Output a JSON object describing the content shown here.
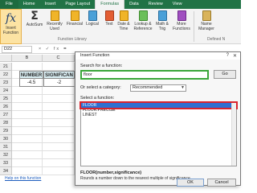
{
  "ribbon": {
    "tabs": [
      "File",
      "Home",
      "Insert",
      "Page Layout",
      "Formulas",
      "Data",
      "Review",
      "View"
    ],
    "active_tab": "Formulas",
    "buttons": {
      "insert_function": "Insert\nFunction",
      "autosum": "AutoSum",
      "recently_used": "Recently\nUsed",
      "financial": "Financial",
      "logical": "Logical",
      "text": "Text",
      "date_time": "Date &\nTime",
      "lookup_reference": "Lookup &\nReference",
      "math_trig": "Math &\nTrig",
      "more_functions": "More\nFunctions",
      "name_manager": "Name\nManager"
    },
    "group_label": "Function Library",
    "group_label2": "Defined N",
    "colors": {
      "tab_bar": "#217346",
      "insert_highlight": "#fce3a3"
    }
  },
  "formula_bar": {
    "name_box": "D22",
    "icons": "× ✓ fx",
    "content": "="
  },
  "grid": {
    "columns": [
      "B",
      "C"
    ],
    "rows": [
      "21",
      "22",
      "23",
      "24",
      "25",
      "26",
      "27",
      "28",
      "29",
      "30",
      "31",
      "32",
      "33",
      "34"
    ],
    "header_cells": [
      "NUMBER",
      "SIGNIFICAN"
    ],
    "value_cells": [
      "-4.5",
      "-2"
    ]
  },
  "dialog": {
    "title": "Insert Function",
    "help_glyph": "?",
    "close_glyph": "✕",
    "search_label": "Search for a function:",
    "search_value": "floor",
    "go_label": "Go",
    "category_label": "Or select a category:",
    "category_value": "Recommended",
    "select_label": "Select a function:",
    "functions": [
      "FLOOR",
      "FLOOR.PRECISE",
      "LINEST"
    ],
    "selected_function": "FLOOR",
    "syntax": "FLOOR(number,significance)",
    "description": "Rounds a number down to the nearest multiple of significance.",
    "help_link": "Help on this function",
    "ok_label": "OK",
    "cancel_label": "Cancel"
  }
}
